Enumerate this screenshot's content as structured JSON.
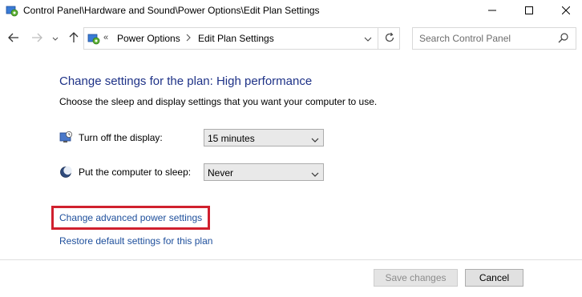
{
  "window": {
    "title": "Control Panel\\Hardware and Sound\\Power Options\\Edit Plan Settings",
    "icon": "control-panel-icon"
  },
  "address_bar": {
    "overflow_chevron": "«",
    "breadcrumbs": [
      {
        "label": "Power Options"
      },
      {
        "label": "Edit Plan Settings"
      }
    ],
    "separator": "›"
  },
  "search": {
    "placeholder": "Search Control Panel",
    "value": ""
  },
  "main": {
    "heading": "Change settings for the plan: High performance",
    "subtext": "Choose the sleep and display settings that you want your computer to use.",
    "settings": [
      {
        "label": "Turn off the display:",
        "icon": "monitor-icon",
        "value": "15 minutes"
      },
      {
        "label": "Put the computer to sleep:",
        "icon": "moon-icon",
        "value": "Never"
      }
    ],
    "links": {
      "advanced": "Change advanced power settings",
      "restore": "Restore default settings for this plan"
    },
    "highlight_color": "#d0202e"
  },
  "footer": {
    "save_label": "Save changes",
    "cancel_label": "Cancel"
  },
  "colors": {
    "heading": "#1e3287",
    "link": "#1e4f9c"
  }
}
